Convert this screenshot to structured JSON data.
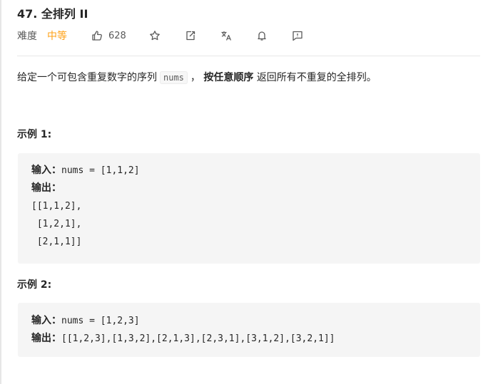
{
  "problem": {
    "title": "47. 全排列 II",
    "difficulty_label": "难度",
    "difficulty": "中等",
    "likes": "628"
  },
  "toolbar": {
    "icons": [
      "thumbs-up-icon",
      "star-icon",
      "share-icon",
      "translate-icon",
      "bell-icon",
      "feedback-icon"
    ]
  },
  "description": {
    "before": "给定一个可包含重复数字的序列",
    "code": "nums",
    "comma": "，",
    "bold": "按任意顺序",
    "after": "返回所有不重复的全排列。"
  },
  "examples": [
    {
      "heading": "示例 1:",
      "input_label": "输入：",
      "input": "nums = [1,1,2]",
      "output_label": "输出：",
      "output_lines": [
        "[[1,1,2],",
        " [1,2,1],",
        " [2,1,1]]"
      ]
    },
    {
      "heading": "示例 2:",
      "input_label": "输入：",
      "input": "nums = [1,2,3]",
      "output_label": "输出：",
      "output": "[[1,2,3],[1,3,2],[2,1,3],[2,3,1],[3,1,2],[3,2,1]]"
    }
  ],
  "colors": {
    "difficulty": "#ffa116",
    "icon": "#595959",
    "code_bg": "#f5f5f5"
  }
}
